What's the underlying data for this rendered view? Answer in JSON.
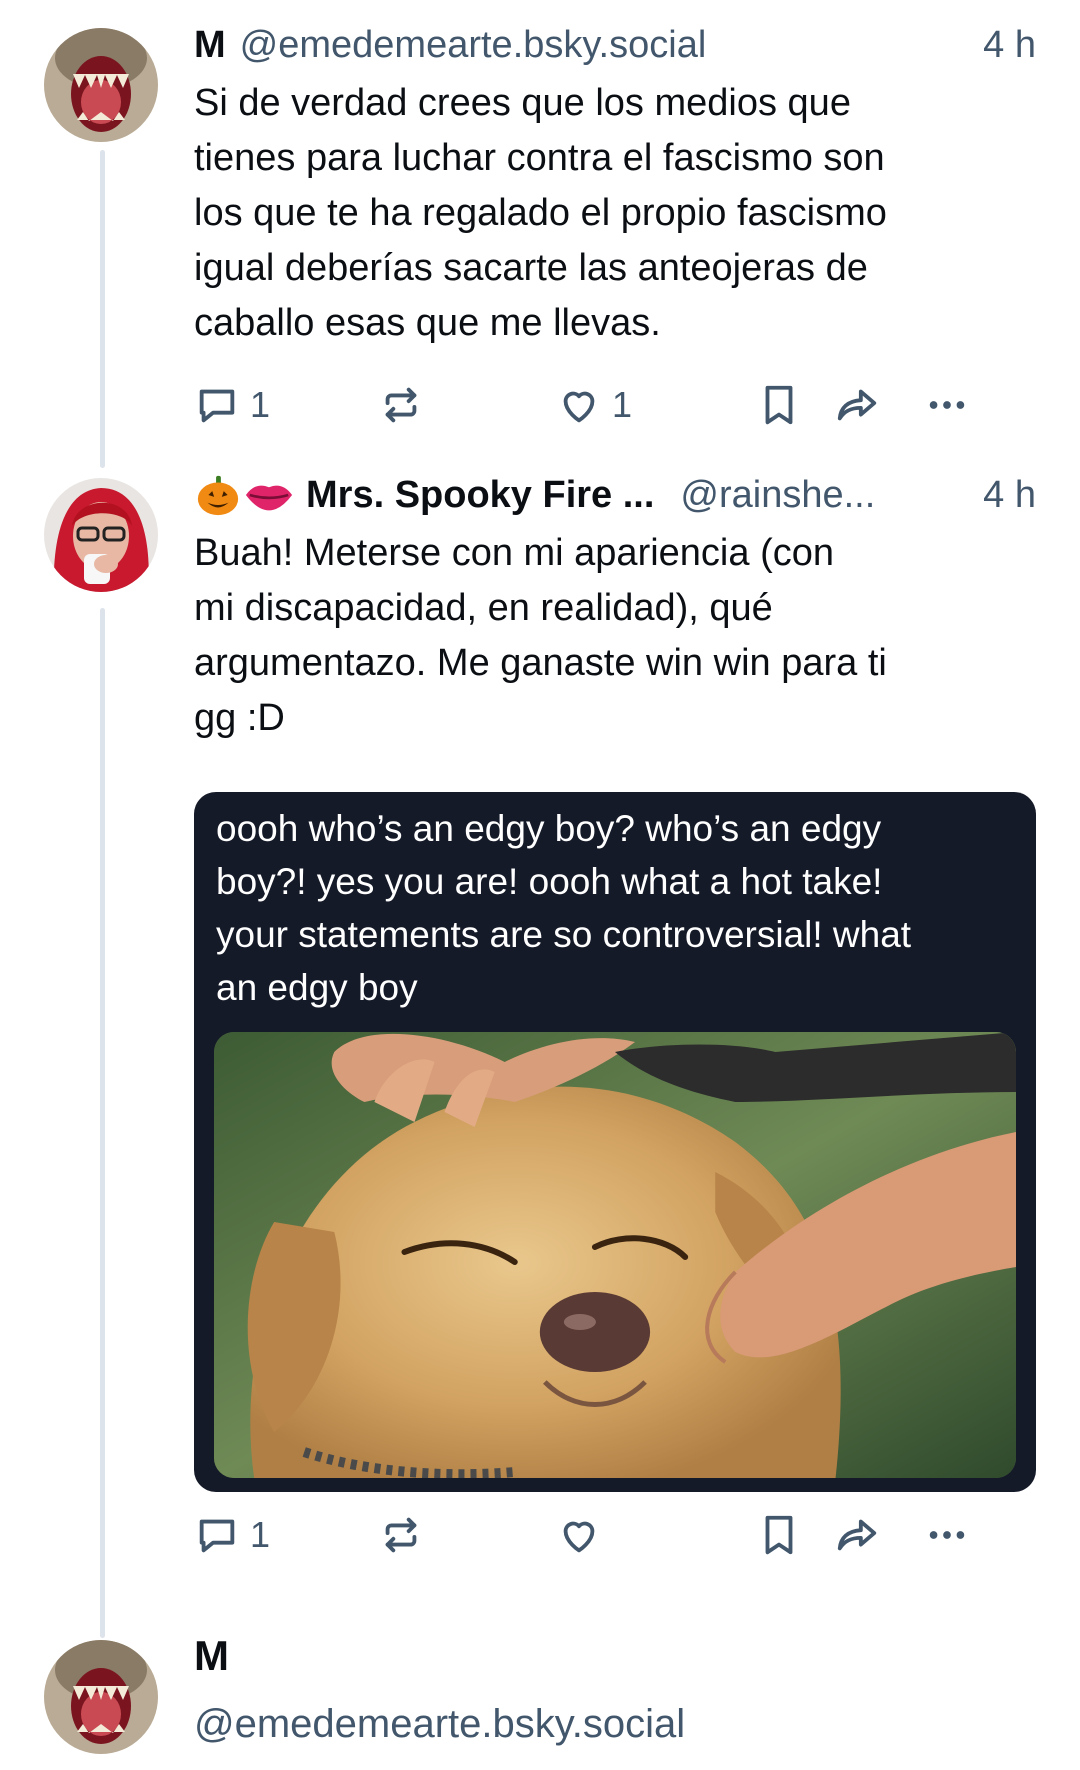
{
  "posts": [
    {
      "author_name": "M",
      "handle": "@emedemearte.bsky.social",
      "time": "4 h",
      "text_lines": [
        "Si de verdad crees que los medios que",
        "tienes para luchar contra el fascismo son",
        "los que te ha regalado el propio fascismo",
        "igual deberías sacarte las anteojeras de",
        "caballo esas que me llevas."
      ],
      "reply_count": "1",
      "like_count": "1"
    },
    {
      "author_name": "Mrs. Spooky Fire ...",
      "handle": "@rainshe...",
      "time": "4 h",
      "text_lines": [
        "Buah! Meterse con mi apariencia (con",
        "mi discapacidad, en realidad), qué",
        "argumentazo. Me ganaste win win para ti",
        "gg :D"
      ],
      "image_text_lines": [
        "oooh who’s an edgy boy? who’s an edgy",
        "boy?! yes you are! oooh what a hot take!",
        "your statements are so controversial! what",
        "an edgy boy"
      ],
      "reply_count": "1",
      "like_count": ""
    }
  ],
  "composer_profile": {
    "author_name": "M",
    "handle": "@emedemearte.bsky.social"
  },
  "icons": {
    "reply": "reply-icon",
    "repost": "repost-icon",
    "like": "heart-icon",
    "bookmark": "bookmark-icon",
    "share": "share-icon",
    "more": "more-icon",
    "emoji": [
      "pumpkin-emoji-icon",
      "lips-emoji-icon"
    ]
  },
  "colors": {
    "muted": "#42576c",
    "thread_line": "#dde3ea",
    "meme_bg": "#151a28"
  }
}
